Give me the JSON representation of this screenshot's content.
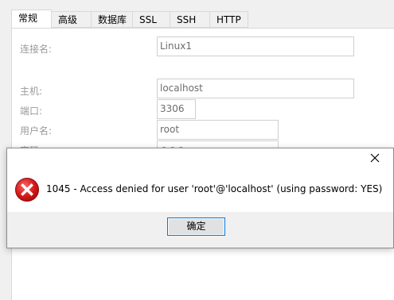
{
  "tabs": [
    {
      "label": "常规",
      "active": true
    },
    {
      "label": "高级",
      "active": false
    },
    {
      "label": "数据库",
      "active": false
    },
    {
      "label": "SSL",
      "active": false
    },
    {
      "label": "SSH",
      "active": false
    },
    {
      "label": "HTTP",
      "active": false
    }
  ],
  "form": {
    "connection_name": {
      "label": "连接名:",
      "value": "Linux1"
    },
    "host": {
      "label": "主机:",
      "value": "localhost"
    },
    "port": {
      "label": "端口:",
      "value": "3306"
    },
    "username": {
      "label": "用户名:",
      "value": "root"
    },
    "password": {
      "label": "密码:",
      "value": "●●●"
    }
  },
  "dialog": {
    "message": "1045 - Access denied for user 'root'@'localhost' (using password: YES)",
    "ok_label": "确定",
    "icon": "error-icon",
    "accent_color": "#0078d7",
    "error_color": "#d71a1a"
  }
}
